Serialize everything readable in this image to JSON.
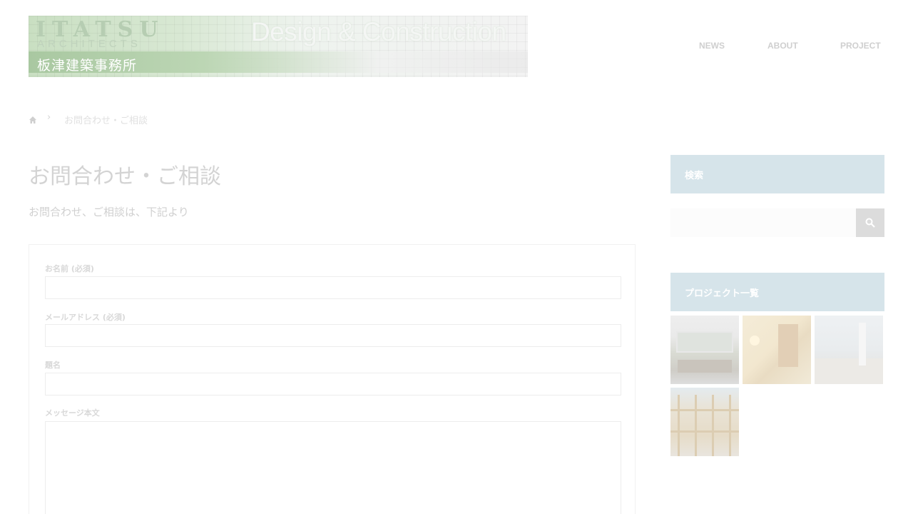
{
  "header": {
    "logo_main": "ITATSU",
    "logo_sub": "ARCHITECTS",
    "logo_jp": "板津建築事務所",
    "tagline": "Design & Construction"
  },
  "nav": [
    "NEWS",
    "ABOUT",
    "PROJECT"
  ],
  "breadcrumb": {
    "home_icon": "home-icon",
    "separator": "›",
    "current": "お問合わせ・ご相談"
  },
  "main": {
    "title": "お問合わせ・ご相談",
    "description": "お問合わせ、ご相談は、下記より",
    "form": {
      "name_label": "お名前 (必須)",
      "email_label": "メールアドレス (必須)",
      "subject_label": "題名",
      "message_label": "メッセージ本文"
    }
  },
  "sidebar": {
    "search_title": "検索",
    "search_icon": "search-icon",
    "projects_title": "プロジェクト一覧",
    "thumbnails": [
      "project-thumb-1",
      "project-thumb-2",
      "project-thumb-3",
      "project-thumb-4"
    ]
  },
  "colors": {
    "widget_head": "#d6e4ea",
    "search_button": "#dcdcdc"
  }
}
